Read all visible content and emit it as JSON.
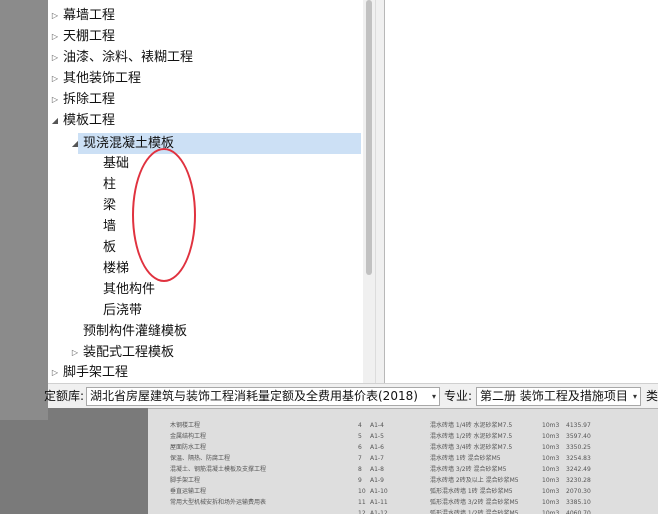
{
  "tree": {
    "items": [
      {
        "label": "幕墙工程",
        "expand": "▷"
      },
      {
        "label": "天棚工程",
        "expand": "▷"
      },
      {
        "label": "油漆、涂料、裱糊工程",
        "expand": "▷"
      },
      {
        "label": "其他装饰工程",
        "expand": "▷"
      },
      {
        "label": "拆除工程",
        "expand": "▷"
      },
      {
        "label": "模板工程",
        "expand": "◢"
      },
      {
        "label": "现浇混凝土模板",
        "expand": "◢"
      },
      {
        "label": "基础"
      },
      {
        "label": "柱"
      },
      {
        "label": "梁"
      },
      {
        "label": "墙"
      },
      {
        "label": "板"
      },
      {
        "label": "楼梯"
      },
      {
        "label": "其他构件"
      },
      {
        "label": "后浇带"
      },
      {
        "label": "预制构件灌缝模板"
      },
      {
        "label": "装配式工程模板",
        "expand": "▷"
      },
      {
        "label": "脚手架工程",
        "expand": "▷"
      }
    ]
  },
  "bottom": {
    "quota_label": "定额库:",
    "quota_value": "湖北省房屋建筑与装饰工程消耗量定额及全费用基价表(2018)",
    "major_label": "专业:",
    "major_value": "第二册 装饰工程及措施项目",
    "extra_label": "类",
    "dropdown_icon": "▾"
  },
  "background_doc": {
    "left_items": [
      "木钢楼工程",
      "金属结构工程",
      "屋面防水工程",
      "保温、隔热、防腐工程",
      "混凝土、钢筋混凝土模板及支撑工程",
      "脚手架工程",
      "垂直运输工程",
      "常用大型机械安拆和场外运输费用表"
    ],
    "rows": [
      {
        "no": "4",
        "code": "A1-4",
        "name": "混水砖墙 1/4砖 水泥砂浆M7.5",
        "unit": "10m3",
        "price": "4135.97"
      },
      {
        "no": "5",
        "code": "A1-5",
        "name": "混水砖墙 1/2砖 水泥砂浆M7.5",
        "unit": "10m3",
        "price": "3597.40"
      },
      {
        "no": "6",
        "code": "A1-6",
        "name": "混水砖墙 3/4砖 水泥砂浆M7.5",
        "unit": "10m3",
        "price": "3350.25"
      },
      {
        "no": "7",
        "code": "A1-7",
        "name": "混水砖墙 1砖 混合砂浆M5",
        "unit": "10m3",
        "price": "3254.83"
      },
      {
        "no": "8",
        "code": "A1-8",
        "name": "混水砖墙 3/2砖 混合砂浆M5",
        "unit": "10m3",
        "price": "3242.49"
      },
      {
        "no": "9",
        "code": "A1-9",
        "name": "混水砖墙 2砖及以上 混合砂浆M5",
        "unit": "10m3",
        "price": "3230.28"
      },
      {
        "no": "10",
        "code": "A1-10",
        "name": "弧形混水砖墙 1砖 混合砂浆M5",
        "unit": "10m3",
        "price": "2070.30"
      },
      {
        "no": "11",
        "code": "A1-11",
        "name": "弧形混水砖墙 3/2砖 混合砂浆M5",
        "unit": "10m3",
        "price": "3385.10"
      },
      {
        "no": "12",
        "code": "A1-12",
        "name": "弧形混水砖墙 1/2砖 混合砂浆M5",
        "unit": "10m3",
        "price": "4060.70"
      }
    ]
  }
}
